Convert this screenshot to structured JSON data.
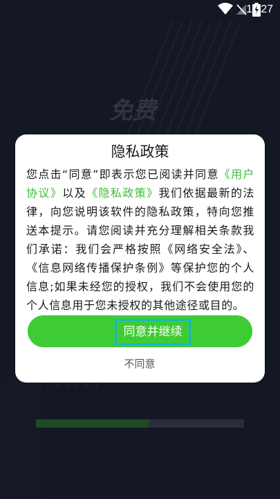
{
  "status_bar": {
    "time": "11:27",
    "icons": [
      "wifi-icon",
      "no-signal-icon",
      "battery-charging-icon"
    ]
  },
  "splash": {
    "title": "免费"
  },
  "dialog": {
    "title": "隐私政策",
    "body": {
      "part1": "您点击“同意”即表示您已阅读并同意",
      "link1": "《用户协议》",
      "part2": "以及",
      "link2": "《隐私政策》",
      "part3": "我们依据最新的法律，向您说明该软件的隐私政策，特向您推送本提示。请您阅读并充分理解相关条款我们承诺：我们会严格按照《网络安全法》、《信息网络传播保护条例》等保护您的个人信息;如果未经您的授权，我们不会使用您的个人信息用于您未授权的其他途径或目的。"
    },
    "agree_label": "同意并继续",
    "disagree_label": "不同意"
  },
  "progress": {
    "value": 0.54
  },
  "colors": {
    "accent": "#3ecc34",
    "link": "#3cbd36",
    "highlight": "#1ab5c9",
    "background": "#141824"
  }
}
